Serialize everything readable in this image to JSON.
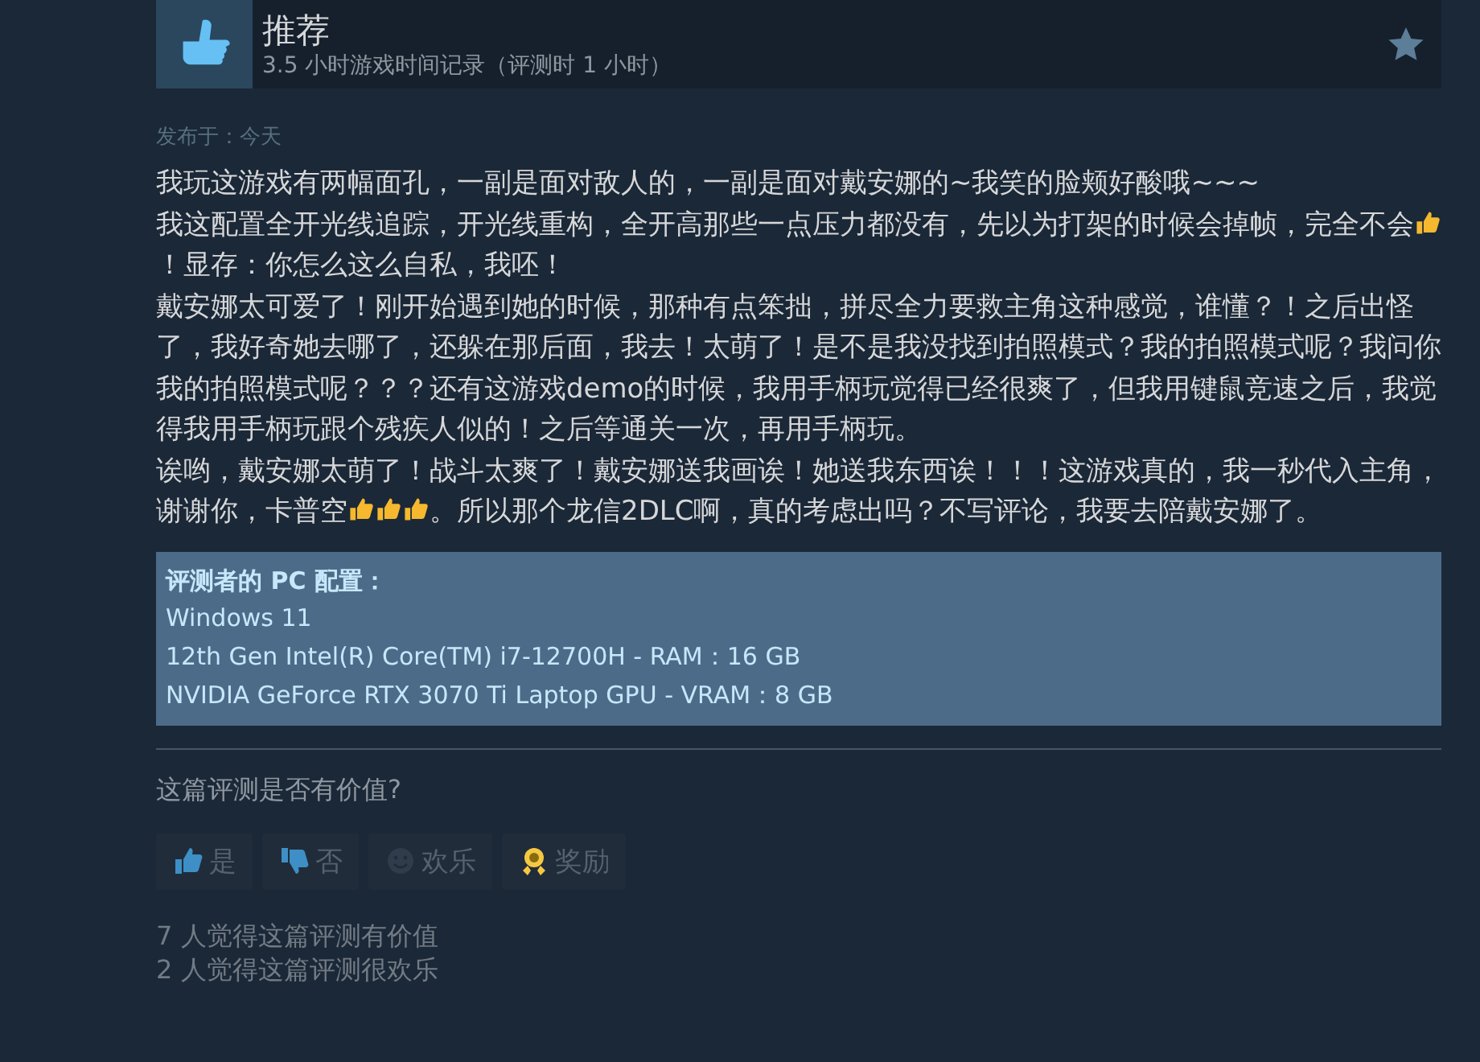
{
  "review": {
    "verdict": "推荐",
    "playtime": "3.5 小时游戏时间记录（评测时 1 小时）",
    "posted": "发布于：今天"
  },
  "paragraphs": [
    [
      {
        "kind": "text",
        "text": "我玩这游戏有两幅面孔，一副是面对敌人的，一副是面对戴安娜的~我笑的脸颊好酸哦~~~"
      }
    ],
    [
      {
        "kind": "text",
        "text": "我这配置全开光线追踪，开光线重构，全开高那些一点压力都没有，先以为打架的时候会掉帧，完全不会"
      },
      {
        "kind": "thumb"
      },
      {
        "kind": "text",
        "text": "！显存：你怎么这么自私，我呸！"
      }
    ],
    [
      {
        "kind": "text",
        "text": "戴安娜太可爱了！刚开始遇到她的时候，那种有点笨拙，拼尽全力要救主角这种感觉，谁懂？！之后出怪了，我好奇她去哪了，还躲在那后面，我去！太萌了！是不是我没找到拍照模式？我的拍照模式呢？我问你我的拍照模式呢？？？还有这游戏demo的时候，我用手柄玩觉得已经很爽了，但我用键鼠竞速之后，我觉得我用手柄玩跟个残疾人似的！之后等通关一次，再用手柄玩。"
      }
    ],
    [
      {
        "kind": "text",
        "text": "诶哟，戴安娜太萌了！战斗太爽了！戴安娜送我画诶！她送我东西诶！！！这游戏真的，我一秒代入主角，谢谢你，卡普空"
      },
      {
        "kind": "thumb"
      },
      {
        "kind": "thumb"
      },
      {
        "kind": "thumb"
      },
      {
        "kind": "text",
        "text": "。所以那个龙信2DLC啊，真的考虑出吗？不写评论，我要去陪戴安娜了。"
      }
    ]
  ],
  "specs": {
    "heading": "评测者的 PC 配置：",
    "lines": [
      "Windows 11",
      "12th Gen Intel(R) Core(TM) i7-12700H - RAM：16 GB",
      "NVIDIA GeForce RTX 3070 Ti Laptop GPU - VRAM：8 GB"
    ]
  },
  "question": "这篇评测是否有价值?",
  "buttons": [
    {
      "kind": "yes",
      "label": "是"
    },
    {
      "kind": "no",
      "label": "否"
    },
    {
      "kind": "funny",
      "label": "欢乐"
    },
    {
      "kind": "award",
      "label": "奖励"
    }
  ],
  "counts": [
    "7 人觉得这篇评测有价值",
    "2 人觉得这篇评测很欢乐"
  ]
}
